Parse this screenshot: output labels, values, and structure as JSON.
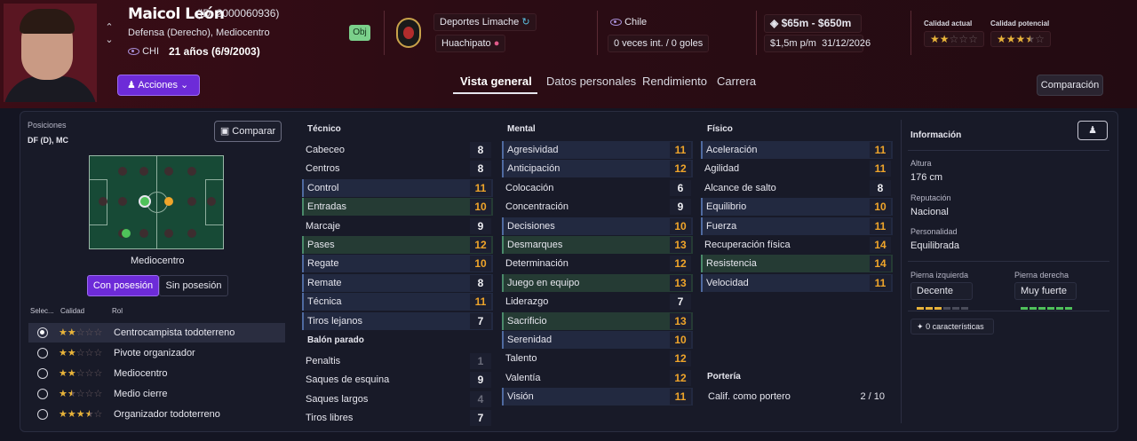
{
  "header": {
    "name": "Maicol León",
    "id_text": "(ID: 2000060936)",
    "positions": "Defensa (Derecho), Mediocentro",
    "nationality_code": "CHI",
    "age": "21 años (6/9/2003)",
    "obj_badge": "Obj",
    "club": "Deportes Limache",
    "loan_club": "Huachipato",
    "country": "Chile",
    "caps": "0 veces int. / 0 goles",
    "value": "$65m - $650m",
    "wage": "$1,5m p/m",
    "contract_end": "31/12/2026",
    "current_quality_label": "Calidad actual",
    "potential_quality_label": "Calidad potencial",
    "current_quality_stars": 2,
    "potential_quality_stars": 3.5,
    "actions_label": "Acciones",
    "compare_button": "Comparación"
  },
  "tabs": [
    {
      "label": "Vista general",
      "active": true
    },
    {
      "label": "Datos personales",
      "active": false
    },
    {
      "label": "Rendimiento",
      "active": false
    },
    {
      "label": "Carrera",
      "active": false
    }
  ],
  "left": {
    "positions_label": "Posiciones",
    "positions_value": "DF (D), MC",
    "compare_label": "Comparar",
    "pitch_role": "Mediocentro",
    "seg_with": "Con posesión",
    "seg_without": "Sin posesión",
    "col_select": "Selec...",
    "col_quality": "Calidad",
    "col_role": "Rol",
    "roles": [
      {
        "name": "Centrocampista todoterreno",
        "stars": 2,
        "selected": true
      },
      {
        "name": "Pivote organizador",
        "stars": 2,
        "selected": false
      },
      {
        "name": "Mediocentro",
        "stars": 2,
        "selected": false
      },
      {
        "name": "Medio cierre",
        "stars": 1.5,
        "selected": false
      },
      {
        "name": "Organizador todoterreno",
        "stars": 3.5,
        "selected": false
      }
    ]
  },
  "attributes": {
    "tecnico_label": "Técnico",
    "tecnico": [
      {
        "name": "Cabeceo",
        "value": "8",
        "style": "pl",
        "color": "w"
      },
      {
        "name": "Centros",
        "value": "8",
        "style": "pl",
        "color": "w"
      },
      {
        "name": "Control",
        "value": "11",
        "style": "hl",
        "color": "o"
      },
      {
        "name": "Entradas",
        "value": "10",
        "style": "hg",
        "color": "o"
      },
      {
        "name": "Marcaje",
        "value": "9",
        "style": "pl",
        "color": "w"
      },
      {
        "name": "Pases",
        "value": "12",
        "style": "hg",
        "color": "o"
      },
      {
        "name": "Regate",
        "value": "10",
        "style": "hl",
        "color": "o"
      },
      {
        "name": "Remate",
        "value": "8",
        "style": "hl",
        "color": "w"
      },
      {
        "name": "Técnica",
        "value": "11",
        "style": "hl",
        "color": "o"
      },
      {
        "name": "Tiros lejanos",
        "value": "7",
        "style": "hl",
        "color": "w"
      }
    ],
    "balon_label": "Balón parado",
    "balon": [
      {
        "name": "Penaltis",
        "value": "1",
        "style": "pl",
        "color": "g"
      },
      {
        "name": "Saques de esquina",
        "value": "9",
        "style": "pl",
        "color": "w"
      },
      {
        "name": "Saques largos",
        "value": "4",
        "style": "pl",
        "color": "g"
      },
      {
        "name": "Tiros libres",
        "value": "7",
        "style": "pl",
        "color": "w"
      }
    ],
    "mental_label": "Mental",
    "mental": [
      {
        "name": "Agresividad",
        "value": "11",
        "style": "hl",
        "color": "o"
      },
      {
        "name": "Anticipación",
        "value": "12",
        "style": "hl",
        "color": "o"
      },
      {
        "name": "Colocación",
        "value": "6",
        "style": "pl",
        "color": "w"
      },
      {
        "name": "Concentración",
        "value": "9",
        "style": "pl",
        "color": "w"
      },
      {
        "name": "Decisiones",
        "value": "10",
        "style": "hl",
        "color": "o"
      },
      {
        "name": "Desmarques",
        "value": "13",
        "style": "hg",
        "color": "o"
      },
      {
        "name": "Determinación",
        "value": "12",
        "style": "pl",
        "color": "o"
      },
      {
        "name": "Juego en equipo",
        "value": "13",
        "style": "hg",
        "color": "o"
      },
      {
        "name": "Liderazgo",
        "value": "7",
        "style": "pl",
        "color": "w"
      },
      {
        "name": "Sacrificio",
        "value": "13",
        "style": "hg",
        "color": "o"
      },
      {
        "name": "Serenidad",
        "value": "10",
        "style": "hl",
        "color": "o"
      },
      {
        "name": "Talento",
        "value": "12",
        "style": "pl",
        "color": "o"
      },
      {
        "name": "Valentía",
        "value": "12",
        "style": "pl",
        "color": "o"
      },
      {
        "name": "Visión",
        "value": "11",
        "style": "hl",
        "color": "o"
      }
    ],
    "fisico_label": "Físico",
    "fisico": [
      {
        "name": "Aceleración",
        "value": "11",
        "style": "hl",
        "color": "o"
      },
      {
        "name": "Agilidad",
        "value": "11",
        "style": "pl",
        "color": "o"
      },
      {
        "name": "Alcance de salto",
        "value": "8",
        "style": "pl",
        "color": "w"
      },
      {
        "name": "Equilibrio",
        "value": "10",
        "style": "hl",
        "color": "o"
      },
      {
        "name": "Fuerza",
        "value": "11",
        "style": "hl",
        "color": "o"
      },
      {
        "name": "Recuperación física",
        "value": "14",
        "style": "pl",
        "color": "o"
      },
      {
        "name": "Resistencia",
        "value": "14",
        "style": "hg",
        "color": "o"
      },
      {
        "name": "Velocidad",
        "value": "11",
        "style": "hl",
        "color": "o"
      }
    ],
    "porteria_label": "Portería",
    "porteria_name": "Calif. como portero",
    "porteria_value": "2 / 10"
  },
  "info": {
    "title": "Información",
    "height_label": "Altura",
    "height": "176 cm",
    "rep_label": "Reputación",
    "rep": "Nacional",
    "pers_label": "Personalidad",
    "pers": "Equilibrada",
    "left_foot_label": "Pierna izquierda",
    "left_foot": "Decente",
    "left_foot_level": 3,
    "right_foot_label": "Pierna derecha",
    "right_foot": "Muy fuerte",
    "right_foot_level": 6,
    "traits": "0 características"
  },
  "colors": {
    "accent": "#6d2bd8",
    "orange": "#f0a52a",
    "green": "#4fc25a",
    "yellow": "#e8b33a"
  }
}
